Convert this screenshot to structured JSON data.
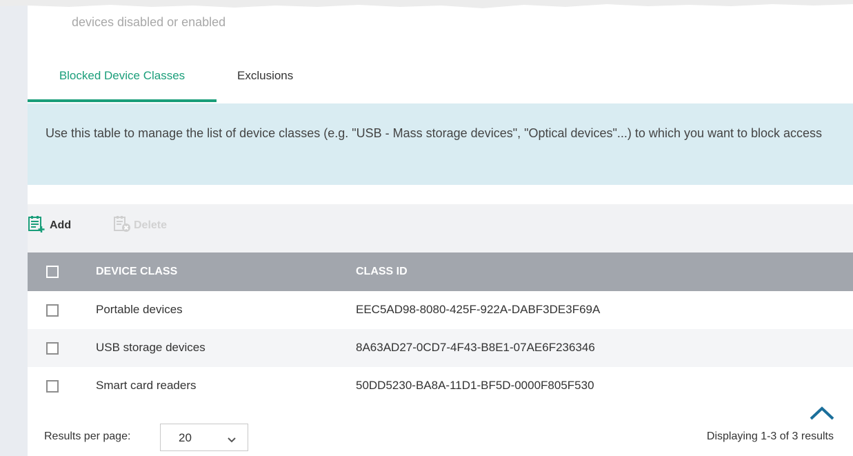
{
  "header_fragment": {
    "text": "devices disabled or enabled"
  },
  "tabs": [
    {
      "label": "Blocked Device Classes",
      "active": true
    },
    {
      "label": "Exclusions",
      "active": false
    }
  ],
  "info": {
    "text": "Use this table to manage the list of device classes (e.g. \"USB - Mass storage devices\", \"Optical devices\"...) to which you want to block access"
  },
  "toolbar": {
    "add_label": "Add",
    "add_icon": "add-list-icon",
    "delete_label": "Delete",
    "delete_icon": "delete-list-icon",
    "delete_enabled": false
  },
  "table": {
    "columns": [
      "DEVICE CLASS",
      "CLASS ID"
    ],
    "rows": [
      {
        "device_class": "Portable devices",
        "class_id": "EEC5AD98-8080-425F-922A-DABF3DE3F69A"
      },
      {
        "device_class": "USB storage devices",
        "class_id": "8A63AD27-0CD7-4F43-B8E1-07AE6F236346"
      },
      {
        "device_class": "Smart card readers",
        "class_id": "50DD5230-BA8A-11D1-BF5D-0000F805F530"
      }
    ]
  },
  "footer": {
    "results_per_page_label": "Results per page:",
    "results_per_page_value": "20",
    "display_text": "Displaying 1-3 of 3 results"
  },
  "colors": {
    "accent": "#1a9e7a",
    "info_bg": "#d9ecf2",
    "header_bg": "#a2a6ad",
    "scroll_icon": "#1b6f9b"
  }
}
